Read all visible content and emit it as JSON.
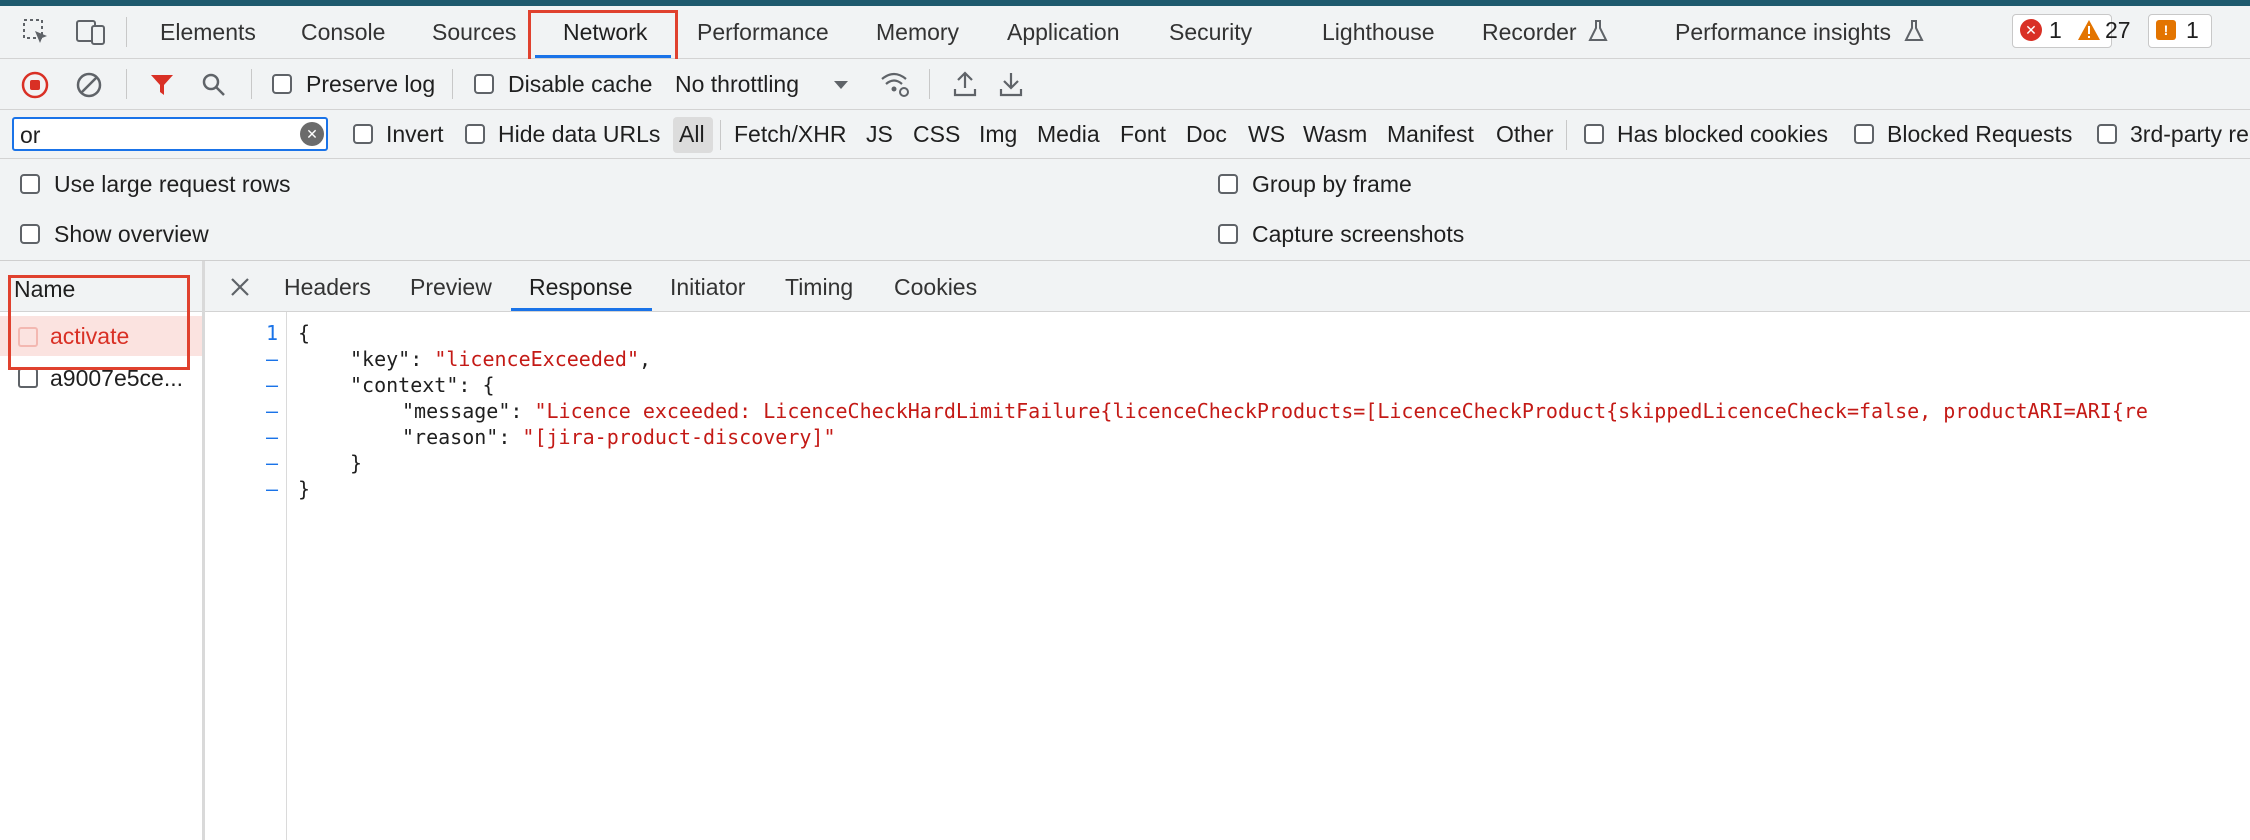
{
  "colors": {
    "accent": "#1a73e8",
    "highlight": "#e0412e",
    "string": "#c41a16",
    "error": "#d93025",
    "warning": "#e37400"
  },
  "main_tabs": [
    "Elements",
    "Console",
    "Sources",
    "Network",
    "Performance",
    "Memory",
    "Application",
    "Security",
    "Lighthouse",
    "Recorder",
    "Performance insights"
  ],
  "active_main_tab": "Network",
  "badges": {
    "errors": "1",
    "warnings": "27",
    "issues": "1"
  },
  "toolbar": {
    "preserve_log": "Preserve log",
    "disable_cache": "Disable cache",
    "throttling": "No throttling"
  },
  "filter": {
    "value": "or",
    "invert": "Invert",
    "hide_data_urls": "Hide data URLs",
    "types": [
      "All",
      "Fetch/XHR",
      "JS",
      "CSS",
      "Img",
      "Media",
      "Font",
      "Doc",
      "WS",
      "Wasm",
      "Manifest",
      "Other"
    ],
    "has_blocked_cookies": "Has blocked cookies",
    "blocked_requests": "Blocked Requests",
    "third_party": "3rd-party re"
  },
  "settings": {
    "large_rows": "Use large request rows",
    "show_overview": "Show overview",
    "group_by_frame": "Group by frame",
    "capture_screenshots": "Capture screenshots"
  },
  "requests": {
    "header": "Name",
    "items": [
      "activate",
      "a9007e5ce..."
    ]
  },
  "detail_tabs": [
    "Headers",
    "Preview",
    "Response",
    "Initiator",
    "Timing",
    "Cookies"
  ],
  "active_detail_tab": "Response",
  "response": {
    "line_numbers": [
      "1",
      "–",
      "–",
      "–",
      "–",
      "–",
      "–"
    ],
    "open_brace": "{",
    "key_name": "\"key\"",
    "key_value": "\"licenceExceeded\"",
    "context_name": "\"context\"",
    "message_name": "\"message\"",
    "message_value": "\"Licence exceeded: LicenceCheckHardLimitFailure{licenceCheckProducts=[LicenceCheckProduct{skippedLicenceCheck=false, productARI=ARI{re",
    "reason_name": "\"reason\"",
    "reason_value": "\"[jira-product-discovery]\"",
    "close_inner": "}",
    "close_brace": "}"
  }
}
